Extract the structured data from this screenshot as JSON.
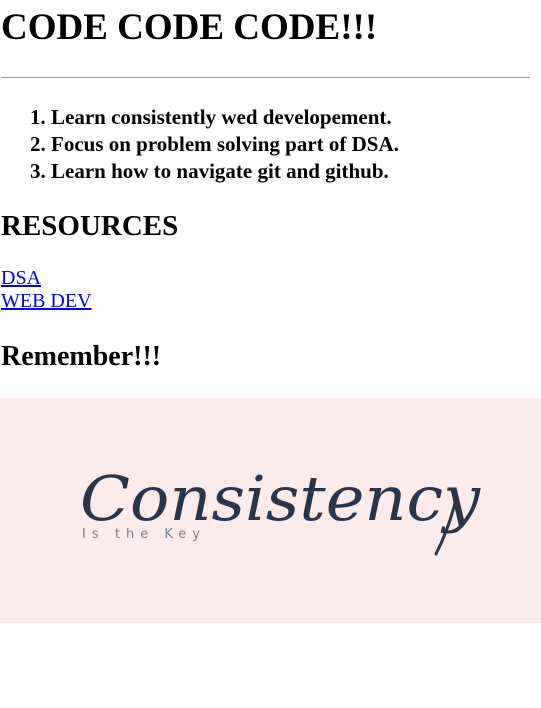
{
  "header": {
    "title": "CODE CODE CODE!!!"
  },
  "goals": [
    "Learn consistently wed developement.",
    "Focus on problem solving part of DSA.",
    "Learn how to navigate git and github."
  ],
  "resources": {
    "heading": "RESOURCES",
    "links": [
      {
        "label": "DSA"
      },
      {
        "label": "WEB DEV"
      }
    ]
  },
  "remember": {
    "heading": "Remember!!!",
    "image": {
      "script_text": "Consistency",
      "tagline": "Is the Key",
      "background_color": "#fcebed",
      "ink_color": "#2c3548"
    }
  },
  "colors": {
    "link": "#0000ee",
    "divider": "#9a9a9a"
  }
}
